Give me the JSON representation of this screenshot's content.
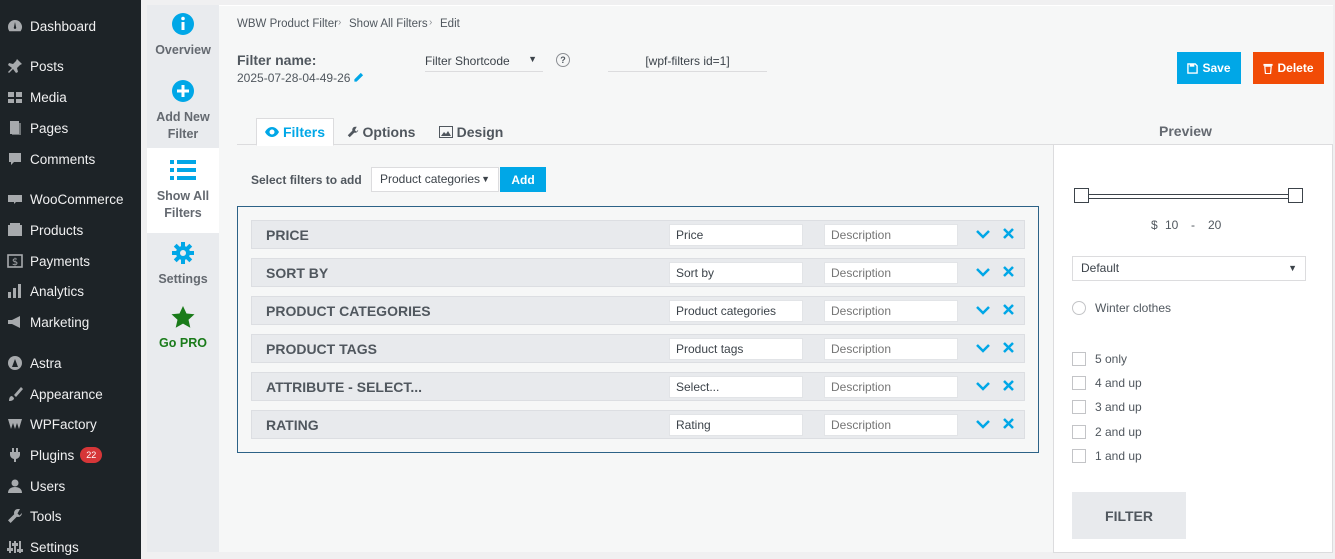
{
  "wp_menu": [
    {
      "label": "Dashboard",
      "icon": "dashboard-icon"
    },
    {
      "label": "Posts",
      "icon": "pin-icon"
    },
    {
      "label": "Media",
      "icon": "media-icon"
    },
    {
      "label": "Pages",
      "icon": "pages-icon"
    },
    {
      "label": "Comments",
      "icon": "comments-icon"
    },
    {
      "label": "WooCommerce",
      "icon": "woocommerce-icon"
    },
    {
      "label": "Products",
      "icon": "products-icon"
    },
    {
      "label": "Payments",
      "icon": "payments-icon"
    },
    {
      "label": "Analytics",
      "icon": "analytics-icon"
    },
    {
      "label": "Marketing",
      "icon": "megaphone-icon"
    },
    {
      "label": "Astra",
      "icon": "astra-icon"
    },
    {
      "label": "Appearance",
      "icon": "brush-icon"
    },
    {
      "label": "WPFactory",
      "icon": "wpfactory-icon"
    },
    {
      "label": "Plugins",
      "icon": "plugin-icon",
      "badge": "22"
    },
    {
      "label": "Users",
      "icon": "users-icon"
    },
    {
      "label": "Tools",
      "icon": "wrench-icon"
    },
    {
      "label": "Settings",
      "icon": "settings-icon"
    }
  ],
  "plugin_nav": [
    {
      "label": "Overview",
      "icon": "info-icon"
    },
    {
      "label": "Add New Filter",
      "icon": "plus-circle-icon"
    },
    {
      "label": "Show All Filters",
      "icon": "list-icon"
    },
    {
      "label": "Settings",
      "icon": "gear-icon"
    },
    {
      "label": "Go PRO",
      "icon": "star-icon"
    }
  ],
  "breadcrumb": [
    "WBW Product Filter",
    "Show All Filters",
    "Edit"
  ],
  "filter_name": {
    "label": "Filter name:",
    "value": "2025-07-28-04-49-26"
  },
  "shortcode": {
    "select": "Filter Shortcode",
    "help": "?",
    "value": "[wpf-filters id=1]"
  },
  "actions": {
    "save": "Save",
    "delete": "Delete"
  },
  "tabs": [
    "Filters",
    "Options",
    "Design"
  ],
  "preview_title": "Preview",
  "add_filter": {
    "label": "Select filters to add",
    "selected": "Product categories",
    "button": "Add"
  },
  "filters": [
    {
      "name": "PRICE",
      "title": "Price",
      "desc_placeholder": "Description"
    },
    {
      "name": "SORT BY",
      "title": "Sort by",
      "desc_placeholder": "Description"
    },
    {
      "name": "PRODUCT CATEGORIES",
      "title": "Product categories",
      "desc_placeholder": "Description"
    },
    {
      "name": "PRODUCT TAGS",
      "title": "Product tags",
      "desc_placeholder": "Description"
    },
    {
      "name": "ATTRIBUTE - SELECT...",
      "title": "Select...",
      "desc_placeholder": "Description"
    },
    {
      "name": "RATING",
      "title": "Rating",
      "desc_placeholder": "Description"
    }
  ],
  "preview": {
    "currency": "$",
    "min": "10",
    "sep": "-",
    "max": "20",
    "sort_selected": "Default",
    "category": "Winter clothes",
    "ratings": [
      "5 only",
      "4 and up",
      "3 and up",
      "2 and up",
      "1 and up"
    ],
    "filter_button": "FILTER"
  },
  "colors": {
    "accent": "#00a7e7",
    "delete": "#f14b06",
    "pro": "#1a7b1a",
    "sidebar": "#1d2327"
  }
}
